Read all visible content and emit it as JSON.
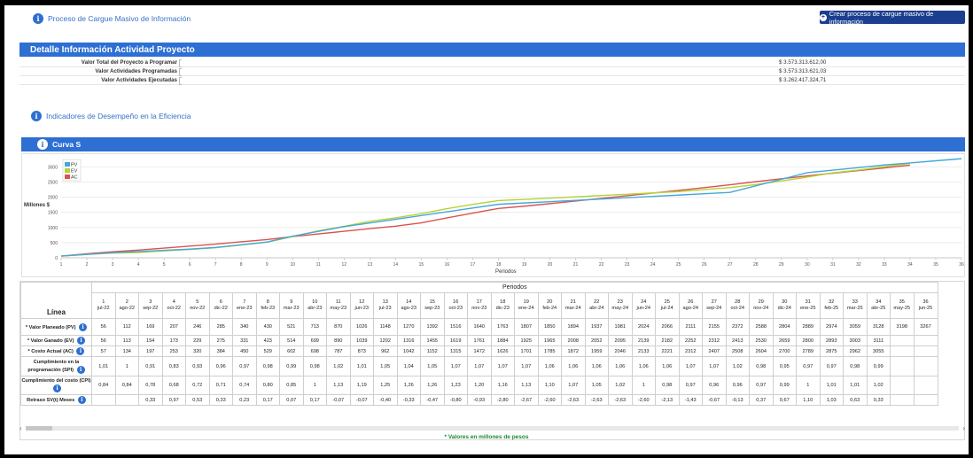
{
  "header": {
    "title": "Proceso de Cargue Masivo de Información",
    "button": "Crear proceso de cargue masivo de información"
  },
  "detail": {
    "title": "Detalle Información Actividad Proyecto",
    "rows": [
      {
        "label": "Valor Total del Proyecto a Programar",
        "value": "$ 3.573.313.612,00"
      },
      {
        "label": "Valor Actividades Programadas",
        "value": "$ 3.573.313.621,03"
      },
      {
        "label": "Valor Actividades Ejecutadas",
        "value": "$ 3.262.417.324,71"
      }
    ]
  },
  "indicators": {
    "title": "Indicadores de Desempeño en la Eficiencia"
  },
  "curve": {
    "title": "Curva S"
  },
  "chart_data": {
    "type": "line",
    "ylabel": "Millones $",
    "xlabel": "Periodos",
    "ylim": [
      0,
      3300
    ],
    "yticks": [
      0,
      500,
      1000,
      1500,
      2000,
      2500,
      3000
    ],
    "x": [
      1,
      2,
      3,
      4,
      5,
      6,
      7,
      8,
      9,
      10,
      11,
      12,
      13,
      14,
      15,
      16,
      17,
      18,
      19,
      20,
      21,
      22,
      23,
      24,
      25,
      26,
      27,
      28,
      29,
      30,
      31,
      32,
      33,
      34,
      35,
      36
    ],
    "legend_position": "top-left",
    "series": [
      {
        "name": "PV",
        "color": "#45a7dc",
        "values": [
          56,
          112,
          169,
          207,
          246,
          285,
          340,
          430,
          521,
          713,
          870,
          1026,
          1148,
          1270,
          1392,
          1516,
          1640,
          1763,
          1807,
          1850,
          1894,
          1937,
          1981,
          2024,
          2066,
          2111,
          2155,
          2372,
          2588,
          2804,
          2889,
          2974,
          3059,
          3128,
          3198,
          3267
        ]
      },
      {
        "name": "EV",
        "color": "#b5d334",
        "values": [
          56,
          113,
          154,
          173,
          229,
          275,
          331,
          423,
          514,
          699,
          890,
          1039,
          1202,
          1316,
          1455,
          1619,
          1761,
          1884,
          1925,
          1965,
          2008,
          2052,
          2095,
          2139,
          2182,
          2252,
          2312,
          2413,
          2530,
          2659,
          2800,
          2893,
          3003,
          3111
        ]
      },
      {
        "name": "AC",
        "color": "#d9534f",
        "values": [
          57,
          134,
          197,
          253,
          320,
          384,
          450,
          529,
          602,
          698,
          787,
          873,
          962,
          1042,
          1152,
          1315,
          1472,
          1626,
          1701,
          1785,
          1872,
          1959,
          2046,
          2133,
          2221,
          2312,
          2407,
          2508,
          2604,
          2700,
          2789,
          2875,
          2962,
          3055
        ]
      }
    ]
  },
  "table": {
    "periods_title": "Periodos",
    "line_title": "Línea",
    "columns": [
      [
        "1",
        "jul-22"
      ],
      [
        "2",
        "ago-22"
      ],
      [
        "3",
        "sep-22"
      ],
      [
        "4",
        "oct-22"
      ],
      [
        "5",
        "nov-22"
      ],
      [
        "6",
        "dic-22"
      ],
      [
        "7",
        "ene-23"
      ],
      [
        "8",
        "feb-23"
      ],
      [
        "9",
        "mar-23"
      ],
      [
        "10",
        "abr-23"
      ],
      [
        "11",
        "may-23"
      ],
      [
        "12",
        "jun-23"
      ],
      [
        "13",
        "jul-23"
      ],
      [
        "14",
        "ago-23"
      ],
      [
        "15",
        "sep-23"
      ],
      [
        "16",
        "oct-23"
      ],
      [
        "17",
        "nov-23"
      ],
      [
        "18",
        "dic-23"
      ],
      [
        "19",
        "ene-24"
      ],
      [
        "20",
        "feb-24"
      ],
      [
        "21",
        "mar-24"
      ],
      [
        "22",
        "abr-24"
      ],
      [
        "23",
        "may-24"
      ],
      [
        "24",
        "jun-24"
      ],
      [
        "25",
        "jul-24"
      ],
      [
        "26",
        "ago-24"
      ],
      [
        "27",
        "sep-24"
      ],
      [
        "28",
        "oct-24"
      ],
      [
        "29",
        "nov-24"
      ],
      [
        "30",
        "dic-24"
      ],
      [
        "31",
        "ene-25"
      ],
      [
        "32",
        "feb-25"
      ],
      [
        "33",
        "mar-25"
      ],
      [
        "34",
        "abr-25"
      ],
      [
        "35",
        "may-25"
      ],
      [
        "36",
        "jun-25"
      ]
    ],
    "rows": [
      {
        "label": "* Valor Planeado (PV)",
        "info": true,
        "h": 19,
        "cells": [
          "56",
          "112",
          "169",
          "207",
          "246",
          "285",
          "340",
          "430",
          "521",
          "713",
          "870",
          "1026",
          "1148",
          "1270",
          "1392",
          "1516",
          "1640",
          "1763",
          "1807",
          "1850",
          "1894",
          "1937",
          "1981",
          "2024",
          "2066",
          "2111",
          "2155",
          "2372",
          "2588",
          "2804",
          "2889",
          "2974",
          "3059",
          "3128",
          "3198",
          "3267"
        ]
      },
      {
        "label": "* Valor Ganado (EV)",
        "info": true,
        "h": 12,
        "cells": [
          "56",
          "113",
          "154",
          "173",
          "229",
          "275",
          "331",
          "423",
          "514",
          "699",
          "890",
          "1039",
          "1202",
          "1316",
          "1455",
          "1619",
          "1761",
          "1884",
          "1925",
          "1965",
          "2008",
          "2052",
          "2095",
          "2139",
          "2182",
          "2252",
          "2312",
          "2413",
          "2530",
          "2659",
          "2800",
          "2893",
          "3003",
          "3111",
          "",
          ""
        ]
      },
      {
        "label": "* Costo Actual (AC)",
        "info": true,
        "h": 12,
        "cells": [
          "57",
          "134",
          "197",
          "253",
          "320",
          "384",
          "450",
          "529",
          "602",
          "698",
          "787",
          "873",
          "962",
          "1042",
          "1152",
          "1315",
          "1472",
          "1626",
          "1701",
          "1785",
          "1872",
          "1959",
          "2046",
          "2133",
          "2221",
          "2312",
          "2407",
          "2508",
          "2604",
          "2700",
          "2789",
          "2875",
          "2962",
          "3055",
          "",
          ""
        ]
      },
      {
        "label": "Cumplimiento en la programación (SPI)",
        "info": true,
        "h": 22,
        "cells": [
          "1,01",
          "1",
          "0,91",
          "0,83",
          "0,93",
          "0,96",
          "0,97",
          "0,98",
          "0,99",
          "0,98",
          "1,02",
          "1,01",
          "1,05",
          "1,04",
          "1,05",
          "1,07",
          "1,07",
          "1,07",
          "1,07",
          "1,06",
          "1,06",
          "1,06",
          "1,06",
          "1,06",
          "1,06",
          "1,07",
          "1,07",
          "1,02",
          "0,98",
          "0,95",
          "0,97",
          "0,97",
          "0,98",
          "0,99",
          "",
          ""
        ]
      },
      {
        "label": "Cumplimiento del costo (CPI)",
        "info": true,
        "h": 21,
        "cells": [
          "0,84",
          "0,84",
          "0,78",
          "0,68",
          "0,72",
          "0,71",
          "0,74",
          "0,80",
          "0,85",
          "1",
          "1,13",
          "1,19",
          "1,25",
          "1,26",
          "1,26",
          "1,23",
          "1,20",
          "1,16",
          "1,13",
          "1,10",
          "1,07",
          "1,05",
          "1,02",
          "1",
          "0,98",
          "0,97",
          "0,96",
          "0,96",
          "0,97",
          "0,99",
          "1",
          "1,01",
          "1,01",
          "1,02",
          "",
          ""
        ]
      },
      {
        "label": "Retraso SV(t) Meses",
        "info": true,
        "h": 12,
        "cells": [
          "",
          "",
          "0,33",
          "0,97",
          "0,53",
          "0,33",
          "0,23",
          "0,17",
          "0,07",
          "0,17",
          "-0,07",
          "-0,07",
          "-0,40",
          "-0,33",
          "-0,47",
          "-0,80",
          "-0,93",
          "-2,80",
          "-2,67",
          "-2,60",
          "-2,63",
          "-2,63",
          "-2,63",
          "-2,60",
          "-2,13",
          "-1,43",
          "-0,67",
          "-0,13",
          "0,37",
          "0,67",
          "1,10",
          "1,03",
          "0,63",
          "0,33",
          "",
          ""
        ]
      }
    ]
  },
  "footer": "* Valores en millones de pesos"
}
